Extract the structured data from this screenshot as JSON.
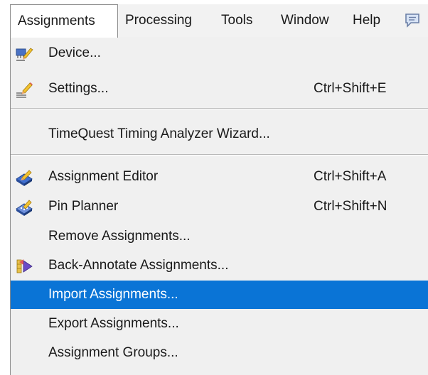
{
  "menubar": {
    "items": [
      {
        "label": "Assignments"
      },
      {
        "label": "Processing"
      },
      {
        "label": "Tools"
      },
      {
        "label": "Window"
      },
      {
        "label": "Help"
      },
      {
        "icon": "speech-bubble-icon"
      }
    ]
  },
  "menu": {
    "items": [
      {
        "label": "Device...",
        "shortcut": "",
        "icon": "chip-pencil-icon"
      },
      {
        "label": "Settings...",
        "shortcut": "Ctrl+Shift+E",
        "icon": "pencil-lines-icon"
      },
      {
        "label": "TimeQuest Timing Analyzer Wizard...",
        "shortcut": ""
      },
      {
        "label": "Assignment Editor",
        "shortcut": "Ctrl+Shift+A",
        "icon": "assignment-editor-icon"
      },
      {
        "label": "Pin Planner",
        "shortcut": "Ctrl+Shift+N",
        "icon": "pin-planner-icon"
      },
      {
        "label": "Remove Assignments...",
        "shortcut": ""
      },
      {
        "label": "Back-Annotate Assignments...",
        "shortcut": "",
        "icon": "back-annotate-icon"
      },
      {
        "label": "Import Assignments...",
        "shortcut": "",
        "highlighted": true
      },
      {
        "label": "Export Assignments...",
        "shortcut": ""
      },
      {
        "label": "Assignment Groups...",
        "shortcut": ""
      }
    ]
  },
  "colors": {
    "highlight": "#0a74d6",
    "menu_background": "#f0f0f0",
    "menubar_background": "#f2f2f2"
  }
}
